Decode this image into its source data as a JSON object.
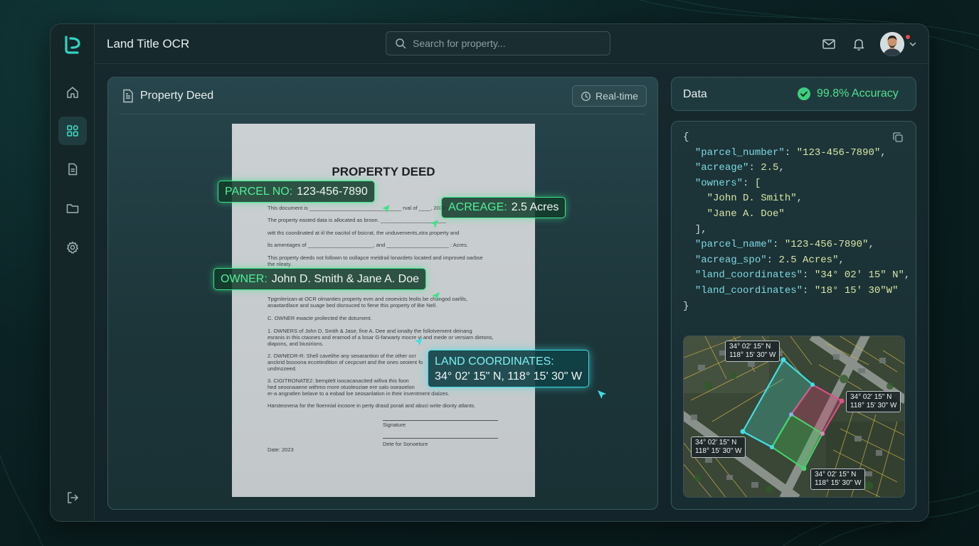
{
  "app": {
    "title": "Land Title OCR"
  },
  "search": {
    "placeholder": "Search for property..."
  },
  "document": {
    "panel_title": "Property Deed",
    "realtime_label": "Real-time",
    "paper": {
      "heading": "PROPERTY DEED",
      "lines": [
        "This document is _______________________________ rval of ____, 2030 i.",
        "The property easted data is allocated as broon. ______________________",
        "witt ths coordinated at iil the oacitol of bsicrat, the unduvements,xtra property and",
        "lis amentages of ______________________, and _____________________ : Acres.",
        "This property deeds not follown to oollapce meldrail lonardets located and improved oarbse",
        "the nleaty.",
        "Tpgmlerizan-at OCR olmanties property evm and ceoevicts leolis be changod oarlils,",
        "anaotardlace and suage bed disrouced to fiene this property of Bie Nell.",
        "C.     OWNER ewacte proliected the dotument.",
        "1.     OWNERS of John D, Smith & Jase, fine A. Dee and ionalty the follotvement deinang",
        "esranis in this ctaones and eramod of a losar G-farwarty mocre yi and mede or versiam dietons,",
        "diapons, and biusirions.",
        "2.     OWNEDR-R: Shell cavelihe any seoarantion of the other ocr",
        "anckrid bssoona eccetindition of cecpcset and the ones seoient fo",
        "undmzzeed.",
        "3.     CIGITRONATE2: bemplelt isocacanacited wifiva this foon",
        "hed seoonaaene withmo more otuoleoziae ere salo oseaoelon",
        "er-a angratlen belave to a eobad loe seosanlation in their inventment dialzes.",
        "Harsteonena for the fioennial incoore in perty drasd porait and abuci write dionty atlants.",
        "Signature",
        "Dete for Sonoeture",
        "Date: 2023"
      ]
    },
    "tags": {
      "parcel": {
        "key": "PARCEL NO:",
        "value": "123-456-7890"
      },
      "acreage": {
        "key": "ACREAGE:",
        "value": "2.5 Acres"
      },
      "owner": {
        "key": "OWNER:",
        "value": "John D. Smith & Jane A. Doe"
      },
      "coords": {
        "key": "LAND COORDINATES:",
        "value": "34° 02' 15\" N, 118° 15' 30\" W"
      }
    }
  },
  "data_panel": {
    "label": "Data",
    "accuracy": "99.8% Accuracy",
    "json_lines": [
      {
        "t": "{"
      },
      {
        "k": "\"parcel_number\"",
        "v": "\"123-456-7890\"",
        "s": ","
      },
      {
        "k": "\"acreage\"",
        "v": "2.5",
        "s": ","
      },
      {
        "k": "\"owners\"",
        "v": "[",
        "s": ""
      },
      {
        "i": "  ",
        "v": "\"John D. Smith\"",
        "s": ","
      },
      {
        "i": "  ",
        "v": "\"Jane A. Doe\"",
        "s": ""
      },
      {
        "t": "  ],"
      },
      {
        "k": "\"parcel_name\"",
        "v": "\"123-456-7890\"",
        "s": ","
      },
      {
        "k": "\"acreag_spo\"",
        "v": "2.5 Acres\"",
        "s": ","
      },
      {
        "k": "\"land_coordinates\"",
        "v": "\"34° 02' 15\" N\"",
        "s": ","
      },
      {
        "k": "\"land_coordinates\"",
        "v": "\"18° 15' 30\"W\"",
        "s": ""
      },
      {
        "t": "}"
      }
    ],
    "map_labels": [
      {
        "lat": "34° 02' 15\" N",
        "lon": "118° 15' 30\" W"
      },
      {
        "lat": "34° 02' 15\" N",
        "lon": "118° 15' 30\" W"
      },
      {
        "lat": "34° 02' 15\" N",
        "lon": "118° 15' 30\" W"
      },
      {
        "lat": "34° 02' 15\" N",
        "lon": "118° 15' 30\" W"
      }
    ]
  },
  "colors": {
    "accent_green": "#3ee38a",
    "accent_cyan": "#3fe0e6",
    "accuracy_green": "#54e08f",
    "notification_dot": "#e5484d"
  }
}
